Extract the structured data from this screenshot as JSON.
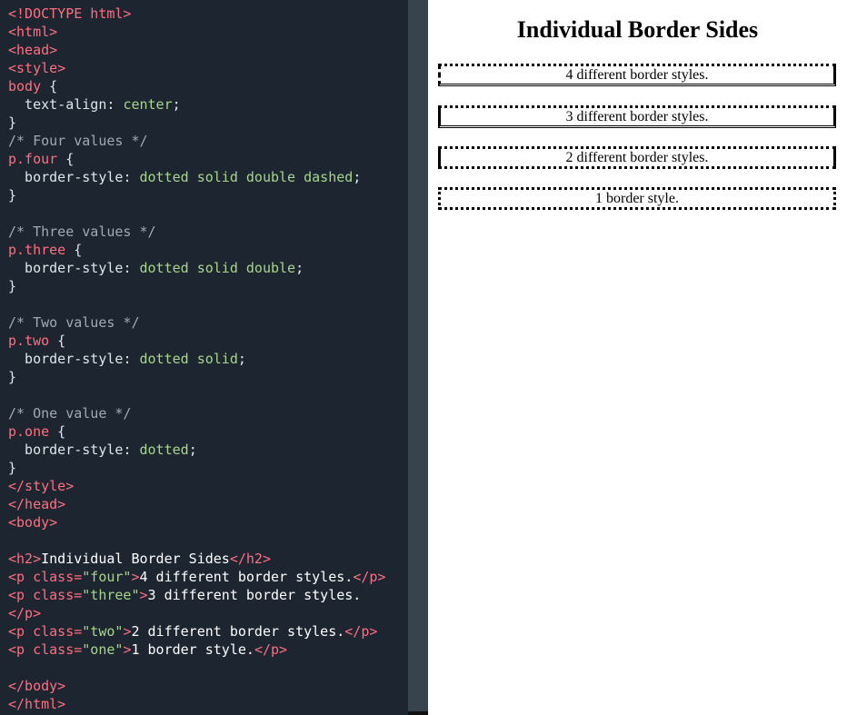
{
  "editor": {
    "lines": [
      [
        {
          "c": "tag",
          "t": "<!DOCTYPE html>"
        }
      ],
      [
        {
          "c": "tag",
          "t": "<html>"
        }
      ],
      [
        {
          "c": "tag",
          "t": "<head>"
        }
      ],
      [
        {
          "c": "tag",
          "t": "<style>"
        }
      ],
      [
        {
          "c": "sel",
          "t": "body"
        },
        {
          "c": "prop",
          "t": " {"
        }
      ],
      [
        {
          "c": "prop",
          "t": "  text-align"
        },
        {
          "c": "prop",
          "t": ": "
        },
        {
          "c": "val",
          "t": "center"
        },
        {
          "c": "prop",
          "t": ";"
        }
      ],
      [
        {
          "c": "prop",
          "t": "}"
        }
      ],
      [
        {
          "c": "cmt",
          "t": "/* Four values */"
        }
      ],
      [
        {
          "c": "sel",
          "t": "p.four"
        },
        {
          "c": "prop",
          "t": " {"
        }
      ],
      [
        {
          "c": "prop",
          "t": "  border-style"
        },
        {
          "c": "prop",
          "t": ": "
        },
        {
          "c": "val",
          "t": "dotted solid double dashed"
        },
        {
          "c": "prop",
          "t": ";"
        }
      ],
      [
        {
          "c": "prop",
          "t": "}"
        }
      ],
      [],
      [
        {
          "c": "cmt",
          "t": "/* Three values */"
        }
      ],
      [
        {
          "c": "sel",
          "t": "p.three"
        },
        {
          "c": "prop",
          "t": " {"
        }
      ],
      [
        {
          "c": "prop",
          "t": "  border-style"
        },
        {
          "c": "prop",
          "t": ": "
        },
        {
          "c": "val",
          "t": "dotted solid double"
        },
        {
          "c": "prop",
          "t": ";"
        }
      ],
      [
        {
          "c": "prop",
          "t": "}"
        }
      ],
      [],
      [
        {
          "c": "cmt",
          "t": "/* Two values */"
        }
      ],
      [
        {
          "c": "sel",
          "t": "p.two"
        },
        {
          "c": "prop",
          "t": " {"
        }
      ],
      [
        {
          "c": "prop",
          "t": "  border-style"
        },
        {
          "c": "prop",
          "t": ": "
        },
        {
          "c": "val",
          "t": "dotted solid"
        },
        {
          "c": "prop",
          "t": ";"
        }
      ],
      [
        {
          "c": "prop",
          "t": "}"
        }
      ],
      [],
      [
        {
          "c": "cmt",
          "t": "/* One value */"
        }
      ],
      [
        {
          "c": "sel",
          "t": "p.one"
        },
        {
          "c": "prop",
          "t": " {"
        }
      ],
      [
        {
          "c": "prop",
          "t": "  border-style"
        },
        {
          "c": "prop",
          "t": ": "
        },
        {
          "c": "val",
          "t": "dotted"
        },
        {
          "c": "prop",
          "t": ";"
        }
      ],
      [
        {
          "c": "prop",
          "t": "}"
        }
      ],
      [
        {
          "c": "tag",
          "t": "</style>"
        }
      ],
      [
        {
          "c": "tag",
          "t": "</head>"
        }
      ],
      [
        {
          "c": "tag",
          "t": "<body>"
        }
      ],
      [],
      [
        {
          "c": "tag",
          "t": "<h2>"
        },
        {
          "c": "txt",
          "t": "Individual Border Sides"
        },
        {
          "c": "tag",
          "t": "</h2>"
        }
      ],
      [
        {
          "c": "tag",
          "t": "<p "
        },
        {
          "c": "tag",
          "t": "class="
        },
        {
          "c": "str",
          "t": "\"four\""
        },
        {
          "c": "tag",
          "t": ">"
        },
        {
          "c": "txt",
          "t": "4 different border styles."
        },
        {
          "c": "tag",
          "t": "</p>"
        }
      ],
      [
        {
          "c": "tag",
          "t": "<p "
        },
        {
          "c": "tag",
          "t": "class="
        },
        {
          "c": "str",
          "t": "\"three\""
        },
        {
          "c": "tag",
          "t": ">"
        },
        {
          "c": "txt",
          "t": "3 different border styles."
        }
      ],
      [
        {
          "c": "tag",
          "t": "</p>"
        }
      ],
      [
        {
          "c": "tag",
          "t": "<p "
        },
        {
          "c": "tag",
          "t": "class="
        },
        {
          "c": "str",
          "t": "\"two\""
        },
        {
          "c": "tag",
          "t": ">"
        },
        {
          "c": "txt",
          "t": "2 different border styles."
        },
        {
          "c": "tag",
          "t": "</p>"
        }
      ],
      [
        {
          "c": "tag",
          "t": "<p "
        },
        {
          "c": "tag",
          "t": "class="
        },
        {
          "c": "str",
          "t": "\"one\""
        },
        {
          "c": "tag",
          "t": ">"
        },
        {
          "c": "txt",
          "t": "1 border style."
        },
        {
          "c": "tag",
          "t": "</p>"
        }
      ],
      [],
      [
        {
          "c": "tag",
          "t": "</body>"
        }
      ],
      [
        {
          "c": "tag",
          "t": "</html>"
        }
      ]
    ]
  },
  "preview": {
    "heading": "Individual Border Sides",
    "p_four": "4 different border styles.",
    "p_three": "3 different border styles.",
    "p_two": "2 different border styles.",
    "p_one": "1 border style."
  },
  "colors": {
    "editor_bg": "#1c2530",
    "tag": "#ff6f80",
    "comment": "#a1aab3",
    "value": "#a8d68a",
    "text": "#dfe6ea",
    "divider": "#38444d"
  }
}
